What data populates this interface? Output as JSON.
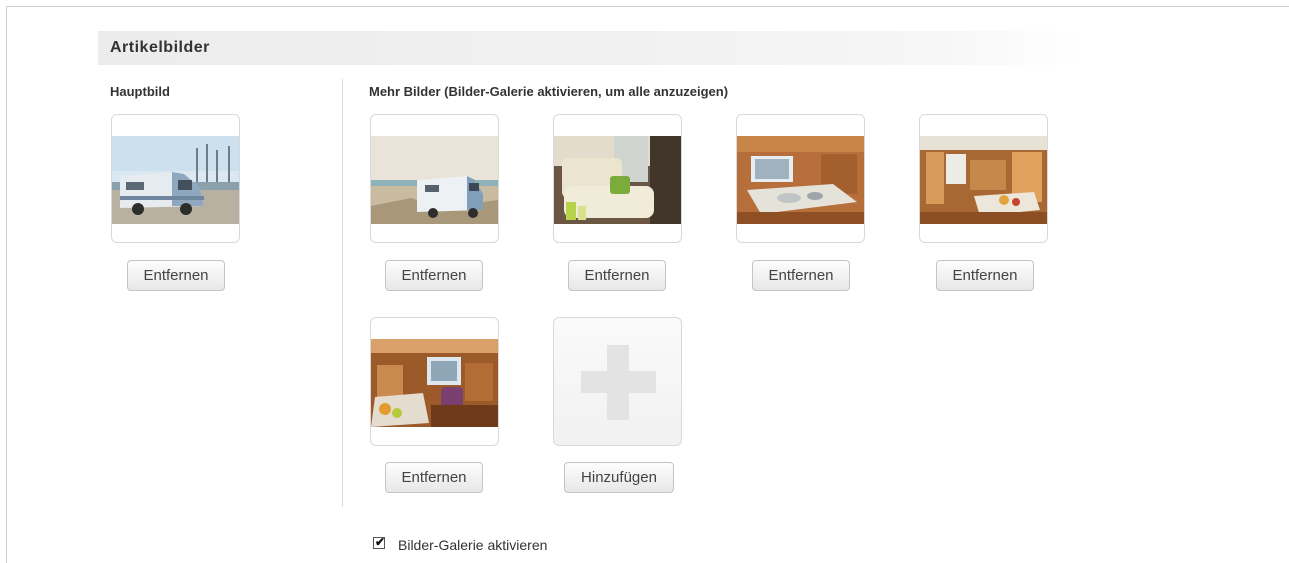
{
  "section": {
    "title": "Artikelbilder"
  },
  "main_image": {
    "label": "Hauptbild",
    "remove_label": "Entfernen",
    "icon": "motorhome-photo"
  },
  "more_images": {
    "label": "Mehr Bilder (Bilder-Galerie aktivieren, um alle anzuzeigen)",
    "items": [
      {
        "icon": "motorhome-beach-photo",
        "remove_label": "Entfernen"
      },
      {
        "icon": "seating-area-photo",
        "remove_label": "Entfernen"
      },
      {
        "icon": "kitchen-photo",
        "remove_label": "Entfernen"
      },
      {
        "icon": "dining-area-photo",
        "remove_label": "Entfernen"
      },
      {
        "icon": "interior-overview-photo",
        "remove_label": "Entfernen"
      }
    ],
    "add_label": "Hinzufügen"
  },
  "gallery": {
    "checked": true,
    "label": "Bilder-Galerie aktivieren"
  }
}
